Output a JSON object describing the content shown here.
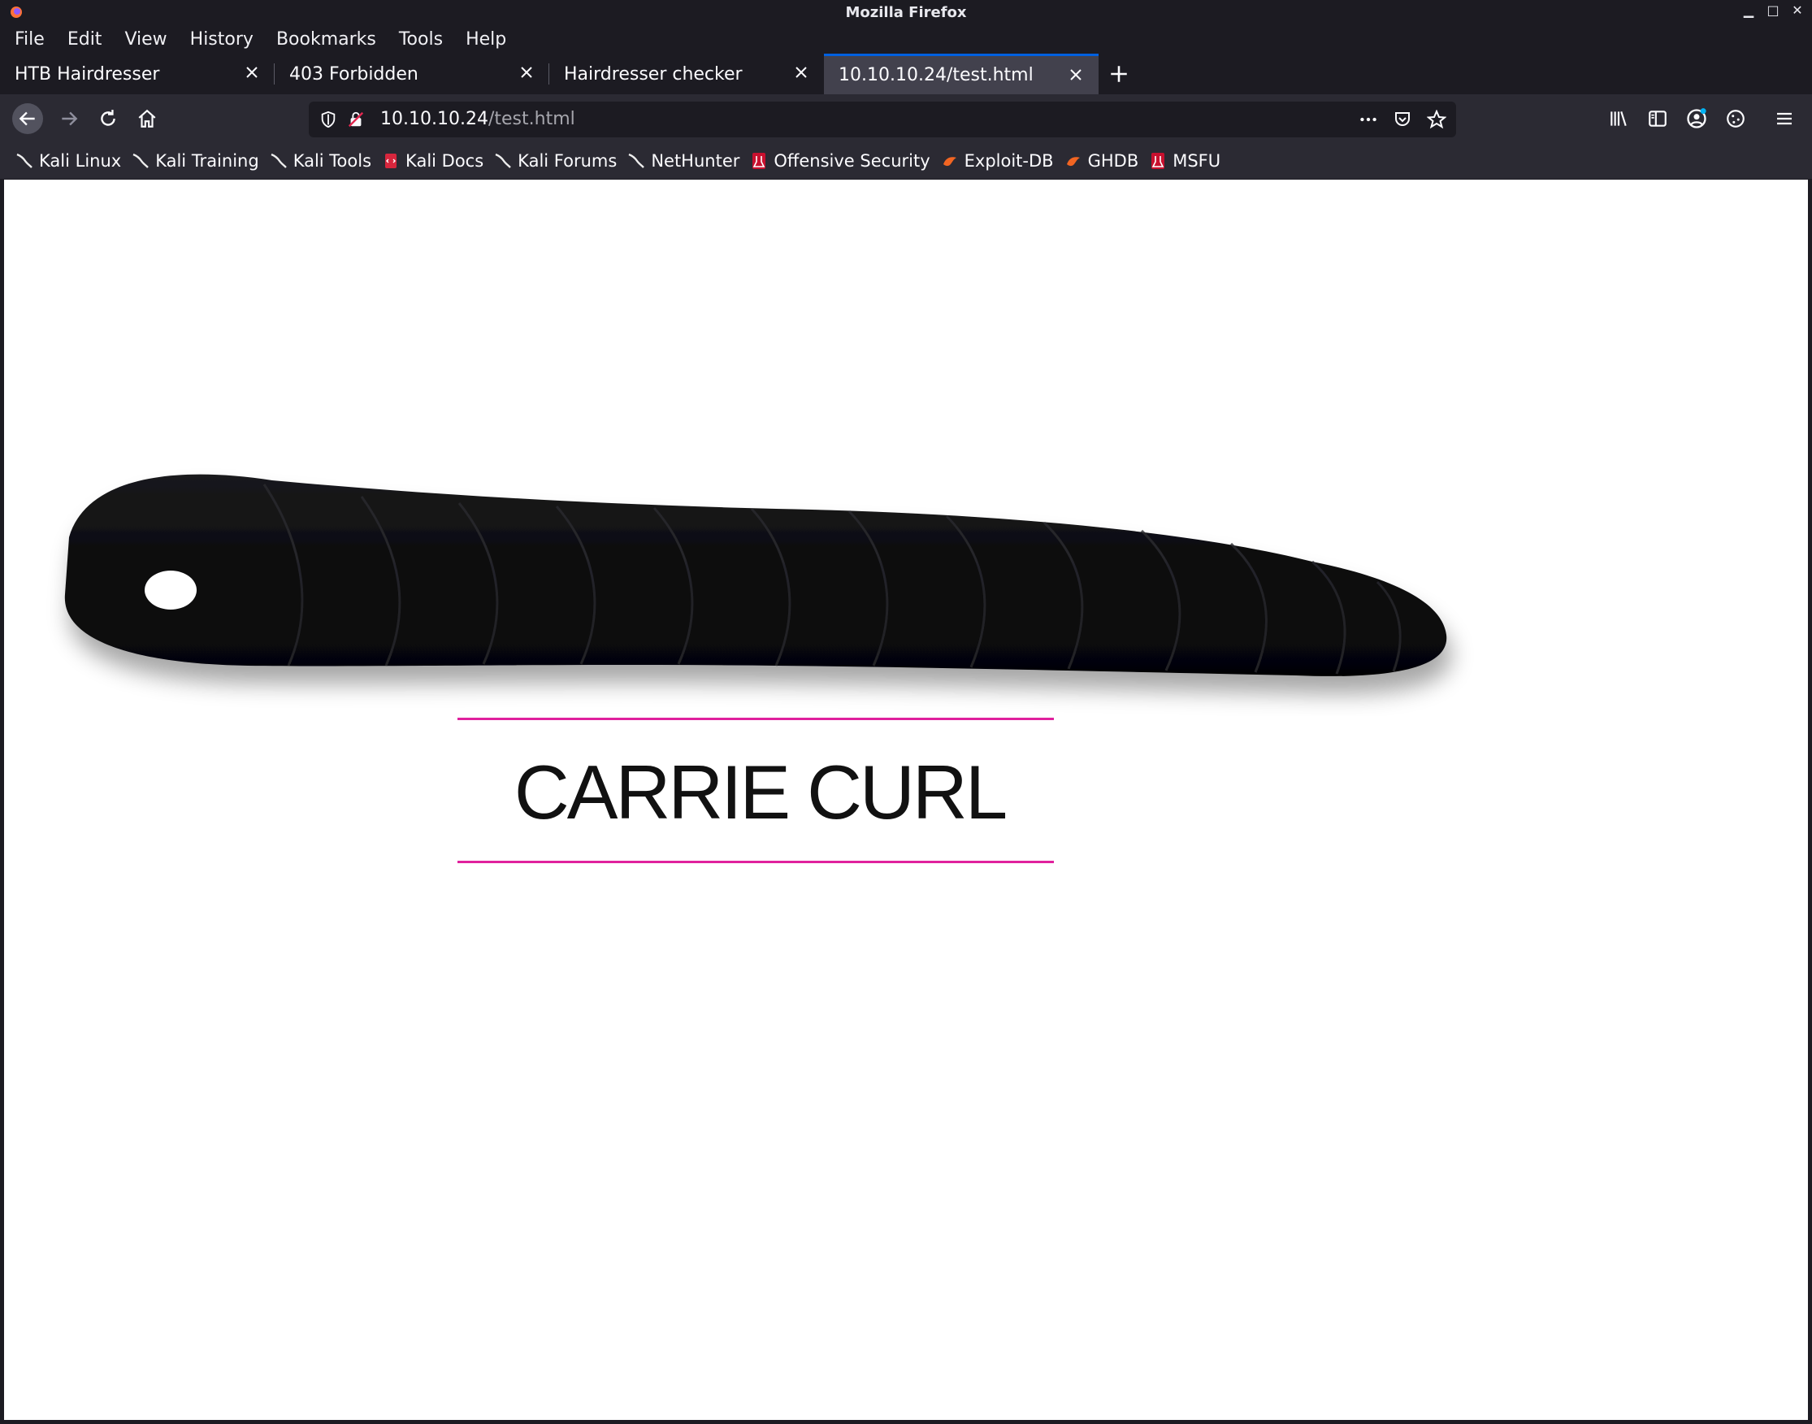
{
  "window": {
    "title": "Mozilla Firefox"
  },
  "menu": [
    "File",
    "Edit",
    "View",
    "History",
    "Bookmarks",
    "Tools",
    "Help"
  ],
  "tabs": [
    {
      "label": "HTB Hairdresser"
    },
    {
      "label": "403 Forbidden"
    },
    {
      "label": "Hairdresser checker"
    },
    {
      "label": "10.10.10.24/test.html"
    }
  ],
  "url": {
    "host": "10.10.10.24",
    "path": "/test.html"
  },
  "bookmarks": [
    {
      "label": "Kali Linux",
      "icon": "kali-dragon-icon"
    },
    {
      "label": "Kali Training",
      "icon": "kali-dragon-icon"
    },
    {
      "label": "Kali Tools",
      "icon": "kali-dragon-icon"
    },
    {
      "label": "Kali Docs",
      "icon": "kali-docs-icon"
    },
    {
      "label": "Kali Forums",
      "icon": "kali-dragon-icon"
    },
    {
      "label": "NetHunter",
      "icon": "kali-dragon-icon"
    },
    {
      "label": "Offensive Security",
      "icon": "offsec-icon"
    },
    {
      "label": "Exploit-DB",
      "icon": "exploit-db-icon"
    },
    {
      "label": "GHDB",
      "icon": "exploit-db-icon"
    },
    {
      "label": "MSFU",
      "icon": "offsec-icon"
    }
  ],
  "page": {
    "product_name": "CARRIE CURL"
  },
  "colors": {
    "accent": "#0060df",
    "pink_rule": "#e0219d",
    "hair": "#111111"
  }
}
